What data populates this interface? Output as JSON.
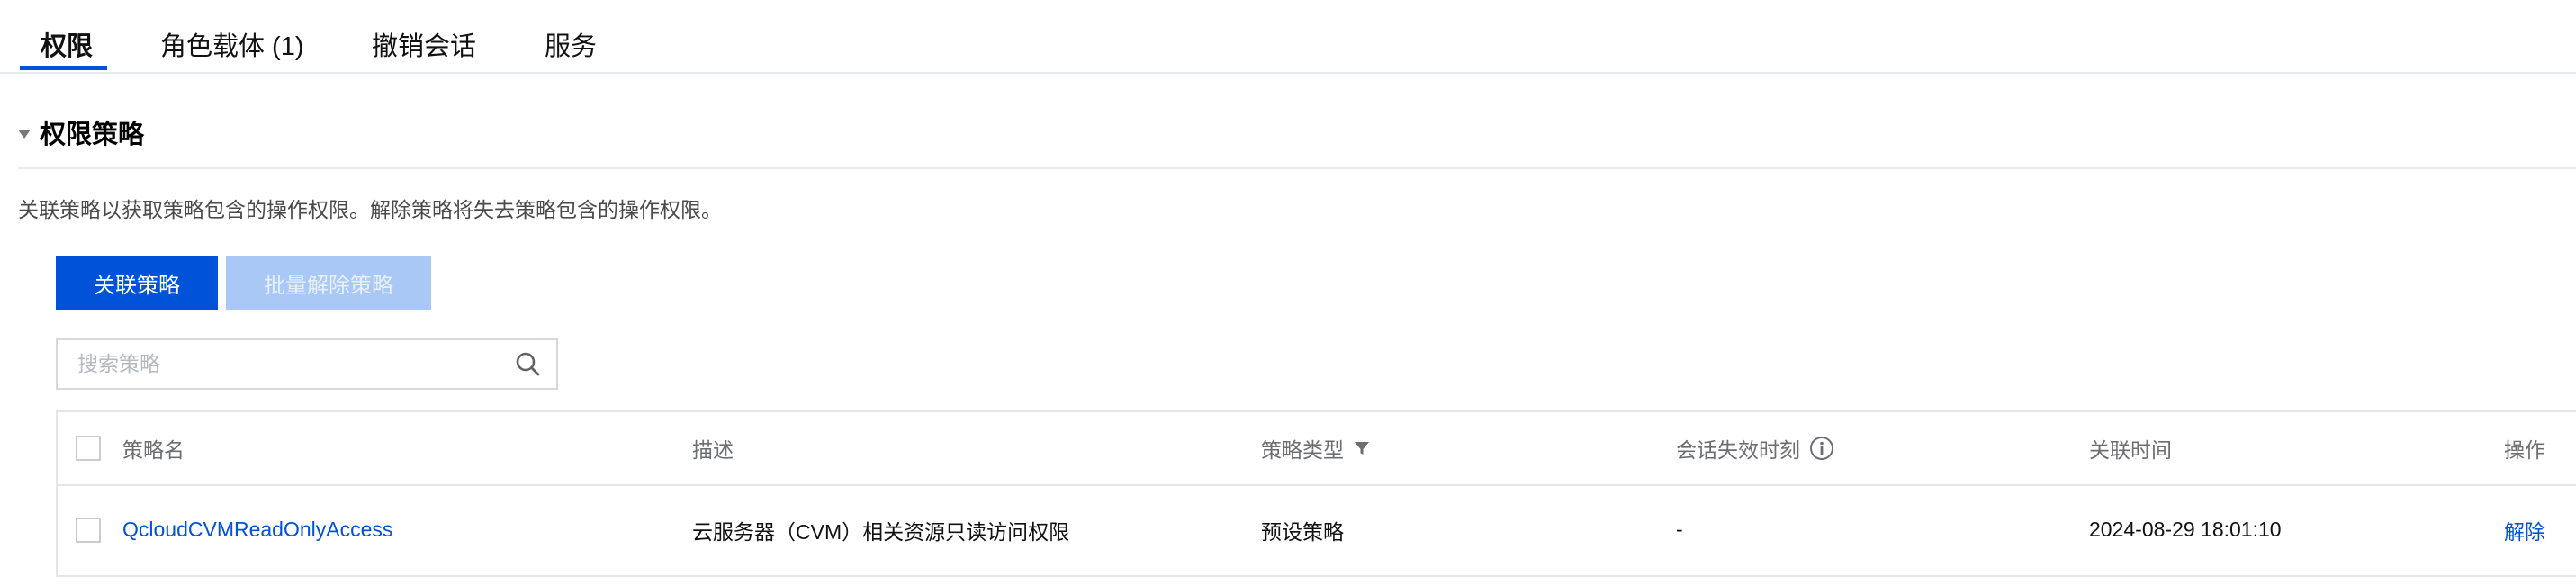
{
  "tabs": [
    {
      "label": "权限"
    },
    {
      "label": "角色载体 (1)"
    },
    {
      "label": "撤销会话"
    },
    {
      "label": "服务"
    }
  ],
  "section": {
    "title": "权限策略",
    "description": "关联策略以获取策略包含的操作权限。解除策略将失去策略包含的操作权限。"
  },
  "buttons": {
    "attach": "关联策略",
    "batch_detach": "批量解除策略"
  },
  "search": {
    "placeholder": "搜索策略",
    "value": ""
  },
  "table": {
    "headers": {
      "name": "策略名",
      "description": "描述",
      "type": "策略类型",
      "session_expiry": "会话失效时刻",
      "attach_time": "关联时间",
      "actions": "操作"
    },
    "rows": [
      {
        "name": "QcloudCVMReadOnlyAccess",
        "description": "云服务器（CVM）相关资源只读访问权限",
        "type": "预设策略",
        "session_expiry": "-",
        "attach_time": "2024-08-29 18:01:10",
        "action": "解除"
      }
    ]
  },
  "colors": {
    "primary": "#0052d9",
    "disabled_button": "#a9c8f5"
  }
}
